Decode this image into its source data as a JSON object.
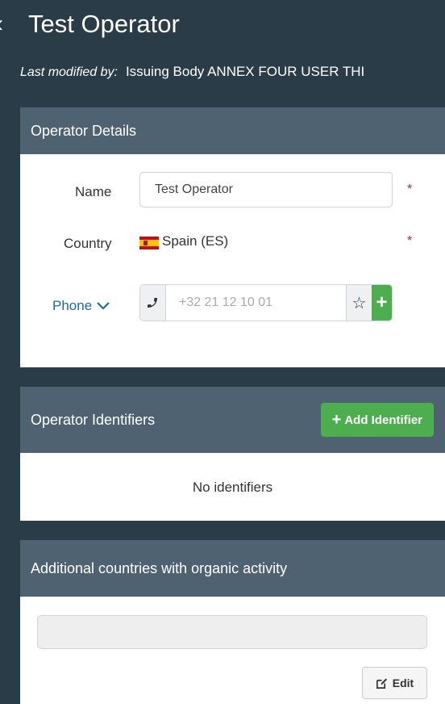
{
  "header": {
    "back_icon": "chevron-left-icon",
    "title": "Test Operator",
    "modified_label": "Last modified by:",
    "modified_value": "Issuing Body ANNEX FOUR USER THI"
  },
  "operator_details": {
    "title": "Operator Details",
    "name_label": "Name",
    "name_value": "Test Operator",
    "country_label": "Country",
    "country_value": "Spain (ES)",
    "required_mark": "*",
    "phone_label": "Phone",
    "phone_placeholder": "+32 21 12 10 01",
    "star_glyph": "☆",
    "plus_glyph": "+"
  },
  "operator_identifiers": {
    "title": "Operator Identifiers",
    "add_label": "Add Identifier",
    "empty_message": "No identifiers"
  },
  "additional_countries": {
    "title": "Additional countries with organic activity",
    "edit_label": "Edit"
  },
  "colors": {
    "background": "#2b3c49",
    "panel_header": "#4f6271",
    "success": "#4cae4f",
    "link": "#1c6aa3",
    "required": "#a0282e"
  }
}
